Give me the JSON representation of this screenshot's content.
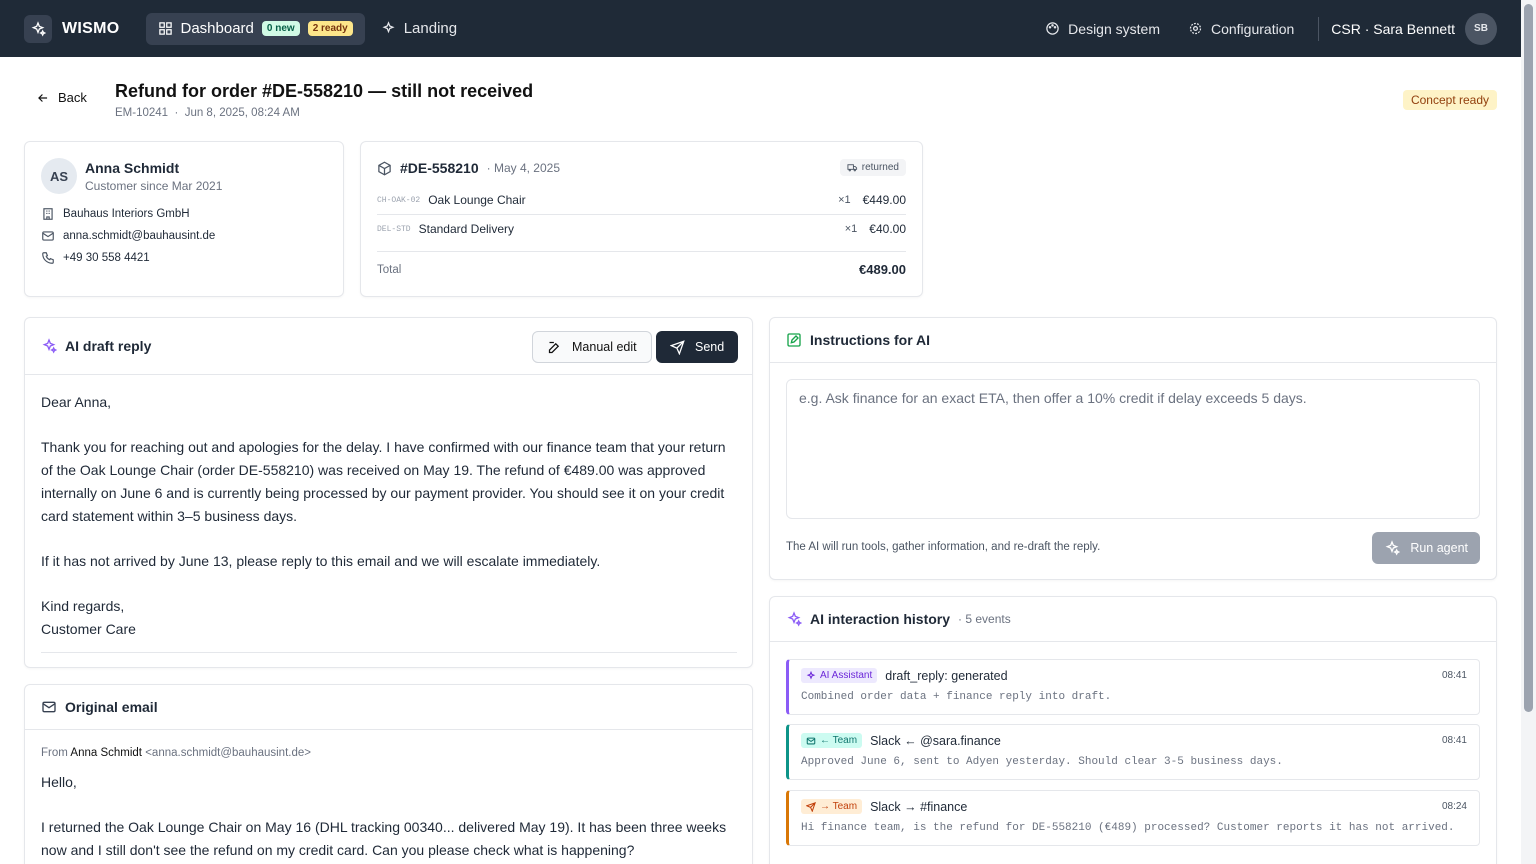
{
  "app": {
    "name": "WISMO"
  },
  "nav": {
    "dashboard": "Dashboard",
    "new_badge": "0 new",
    "ready_badge": "2 ready",
    "landing": "Landing",
    "design_system": "Design system",
    "configuration": "Configuration",
    "user": "CSR · Sara Bennett",
    "user_initials": "SB"
  },
  "header": {
    "back": "Back",
    "title": "Refund for order #DE-558210 — still not received",
    "ticket_id": "EM-10241",
    "date": "Jun 8, 2025, 08:24 AM",
    "status": "Concept ready"
  },
  "customer": {
    "initials": "AS",
    "name": "Anna Schmidt",
    "since": "Customer since Mar 2021",
    "company": "Bauhaus Interiors GmbH",
    "email": "anna.schmidt@bauhausint.de",
    "phone": "+49 30 558 4421"
  },
  "order": {
    "number": "#DE-558210",
    "date": "· May 4, 2025",
    "status": "returned",
    "lines": [
      {
        "sku": "CH-OAK-02",
        "name": "Oak Lounge Chair",
        "qty": "×1",
        "price": "€449.00"
      },
      {
        "sku": "DEL-STD",
        "name": "Standard Delivery",
        "qty": "×1",
        "price": "€40.00"
      }
    ],
    "total_label": "Total",
    "total": "€489.00"
  },
  "draft": {
    "title": "AI draft reply",
    "manual_edit": "Manual edit",
    "send": "Send",
    "body": "Dear Anna,\n\nThank you for reaching out and apologies for the delay. I have confirmed with our finance team that your return of the Oak Lounge Chair (order DE-558210) was received on May 19. The refund of €489.00 was approved internally on June 6 and is currently being processed by our payment provider. You should see it on your credit card statement within 3–5 business days.\n\nIf it has not arrived by June 13, please reply to this email and we will escalate immediately.\n\nKind regards,\nCustomer Care"
  },
  "instructions": {
    "title": "Instructions for AI",
    "placeholder": "e.g. Ask finance for an exact ETA, then offer a 10% credit if delay exceeds 5 days.",
    "hint": "The AI will run tools, gather information, and re-draft the reply.",
    "run": "Run agent"
  },
  "history": {
    "title": "AI interaction history",
    "count": "· 5 events",
    "events": [
      {
        "tag": "AI Assistant",
        "title": "draft_reply: generated",
        "time": "08:41",
        "body": "Combined order data + finance reply into draft.",
        "color": "#8b5cf6"
      },
      {
        "tag": "← Team",
        "title": "Slack ← @sara.finance",
        "time": "08:41",
        "body": "Approved June 6, sent to Adyen yesterday. Should clear 3-5 business days.",
        "color": "#0d9488"
      },
      {
        "tag": "→ Team",
        "title": "Slack → #finance",
        "time": "08:24",
        "body": "Hi finance team, is the refund for DE-558210 (€489) processed? Customer reports it has not arrived.",
        "color": "#d97706"
      }
    ]
  },
  "original": {
    "title": "Original email",
    "from_label": "From",
    "from_name": "Anna Schmidt",
    "from_email": "<anna.schmidt@bauhausint.de>",
    "body": "Hello,\n\nI returned the Oak Lounge Chair on May 16 (DHL tracking 00340... delivered May 19). It has been three weeks now and I still don't see the refund on my credit card. Can you please check what is happening?"
  }
}
